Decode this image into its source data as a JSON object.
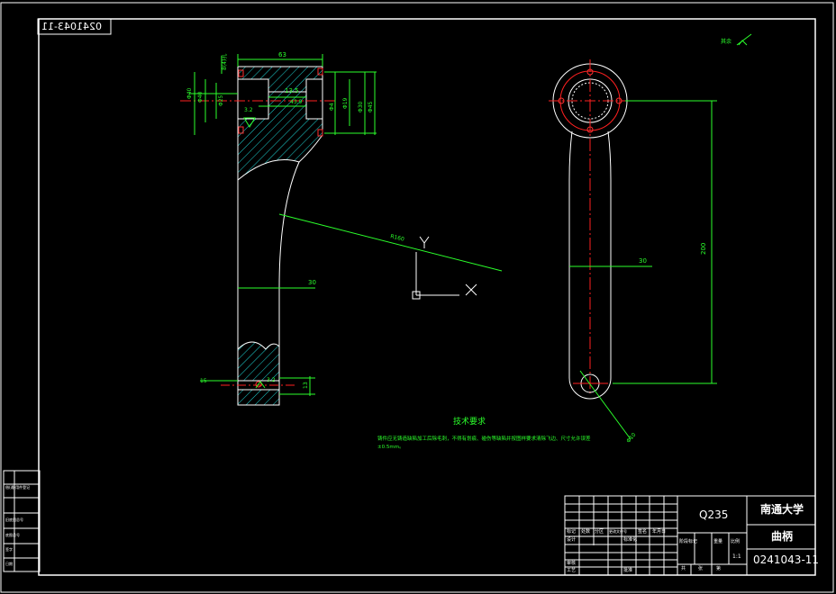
{
  "drawing": {
    "stamp_number": "0241043-11",
    "roughness_note": "其余",
    "tech_requirements": {
      "title": "技术要求",
      "line1": "铸件应无铸造缺陷加工后除毛刺，不得有划痕、碰伤等缺陷并按图样要求清除飞边、尺寸允许误差",
      "line2": "±0.5mm。"
    },
    "dimensions": {
      "top_width": "63",
      "bore_depth": "13.5",
      "inner_length": "43.9",
      "left_dia_1": "Φ40",
      "left_dia_2": "Φ40",
      "left_dia_3": "Φ25",
      "right_dia_1": "Φ19",
      "right_dia_2": "Φ30",
      "right_dia_3": "Φ45",
      "slot_label": "Φ4",
      "flange_note": "8(4)孔",
      "radius": "R160",
      "shaft_width": "30",
      "bottom_hole": "15",
      "bottom_thk": "13",
      "roughness_top": "3.2",
      "roughness_bottom": "3.2",
      "right_width": "30",
      "right_length": "200",
      "small_dia": "Φ10"
    },
    "ucs": {
      "y": "Y",
      "x": "X"
    }
  },
  "title_block": {
    "material": "Q235",
    "school": "南通大学",
    "part_name": "曲柄",
    "drawing_no": "0241043-11",
    "scale": "1:1",
    "headers": {
      "mark": "标记",
      "count": "处数",
      "zone": "分区",
      "change_doc": "更改文件号",
      "sign": "签名",
      "date": "年月日",
      "design": "设计",
      "std": "标准化",
      "stage_mark": "阶段标记",
      "weight": "重量",
      "scale_lbl": "比例",
      "review": "审核",
      "process": "工艺",
      "approve": "批准",
      "total": "共",
      "sheets": "张",
      "page": "第"
    }
  },
  "side_table": {
    "rows": [
      "借(通)用件登记",
      "旧底图总号",
      "底图总号",
      "签字",
      "日期"
    ]
  }
}
